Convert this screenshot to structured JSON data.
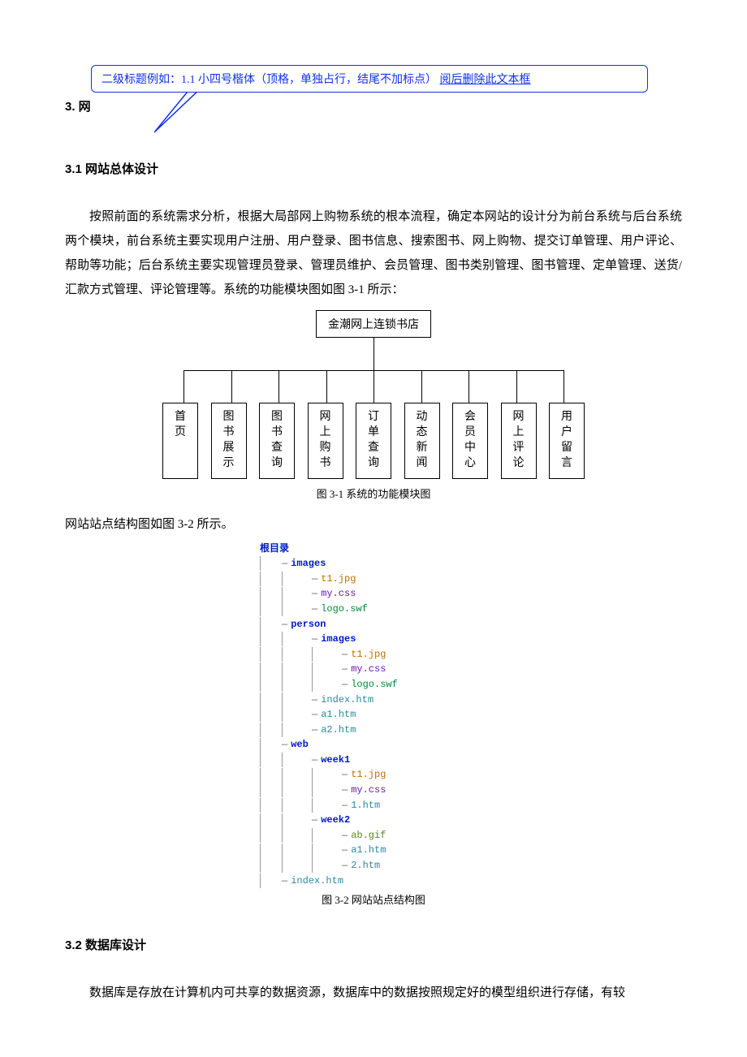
{
  "callout": {
    "text_prefix": "二级标题例如：1.1 小四号楷体（顶格，单独占行，结尾不加标点）",
    "text_underline": "阅后删除此文本框"
  },
  "chapter_number": "3.  网",
  "section31_title": "3.1  网站总体设计",
  "para1": "按照前面的系统需求分析，根据大局部网上购物系统的根本流程，确定本网站的设计分为前台系统与后台系统两个模块，前台系统主要实现用户注册、用户登录、图书信息、搜索图书、网上购物、提交订单管理、用户评论、帮助等功能；后台系统主要实现管理员登录、管理员维护、会员管理、图书类别管理、图书管理、定单管理、送货/汇款方式管理、评论管理等。系统的功能模块图如图 3-1 所示：",
  "diagram1": {
    "root": "金潮网上连锁书店",
    "nodes": [
      "首页",
      "图书展示",
      "图书查询",
      "网上购书",
      "订单查询",
      "动态新闻",
      "会员中心",
      "网上评论",
      "用户留言"
    ],
    "caption": "图 3-1    系统的功能模块图"
  },
  "para2": "网站站点结构图如图 3-2 所示。",
  "tree": {
    "caption": "图 3-2    网站站点结构图",
    "root": "根目录",
    "nodes": [
      {
        "d": 1,
        "t": "dir",
        "n": "images"
      },
      {
        "d": 2,
        "t": "file-img",
        "n": "t1.jpg"
      },
      {
        "d": 2,
        "t": "file-css",
        "n": "my.css"
      },
      {
        "d": 2,
        "t": "file-swf",
        "n": "logo.swf"
      },
      {
        "d": 1,
        "t": "dir",
        "n": "person"
      },
      {
        "d": 2,
        "t": "dir",
        "n": "images"
      },
      {
        "d": 3,
        "t": "file-img",
        "n": "t1.jpg"
      },
      {
        "d": 3,
        "t": "file-css",
        "n": "my.css"
      },
      {
        "d": 3,
        "t": "file-swf",
        "n": "logo.swf"
      },
      {
        "d": 2,
        "t": "file-htm",
        "n": "index.htm"
      },
      {
        "d": 2,
        "t": "file-htm",
        "n": "a1.htm"
      },
      {
        "d": 2,
        "t": "file-htm",
        "n": "a2.htm"
      },
      {
        "d": 1,
        "t": "dir",
        "n": "web"
      },
      {
        "d": 2,
        "t": "dir",
        "n": "week1"
      },
      {
        "d": 3,
        "t": "file-img",
        "n": "t1.jpg"
      },
      {
        "d": 3,
        "t": "file-css",
        "n": "my.css"
      },
      {
        "d": 3,
        "t": "file-htm",
        "n": "1.htm"
      },
      {
        "d": 2,
        "t": "dir",
        "n": "week2"
      },
      {
        "d": 3,
        "t": "file-gif",
        "n": "ab.gif"
      },
      {
        "d": 3,
        "t": "file-htm",
        "n": "a1.htm"
      },
      {
        "d": 3,
        "t": "file-htm",
        "n": "2.htm"
      },
      {
        "d": 1,
        "t": "file-htm",
        "n": "index.htm"
      }
    ]
  },
  "section32_title": "3.2 数据库设计",
  "para3": "数据库是存放在计算机内可共享的数据资源，数据库中的数据按照规定好的模型组织进行存储，有较"
}
